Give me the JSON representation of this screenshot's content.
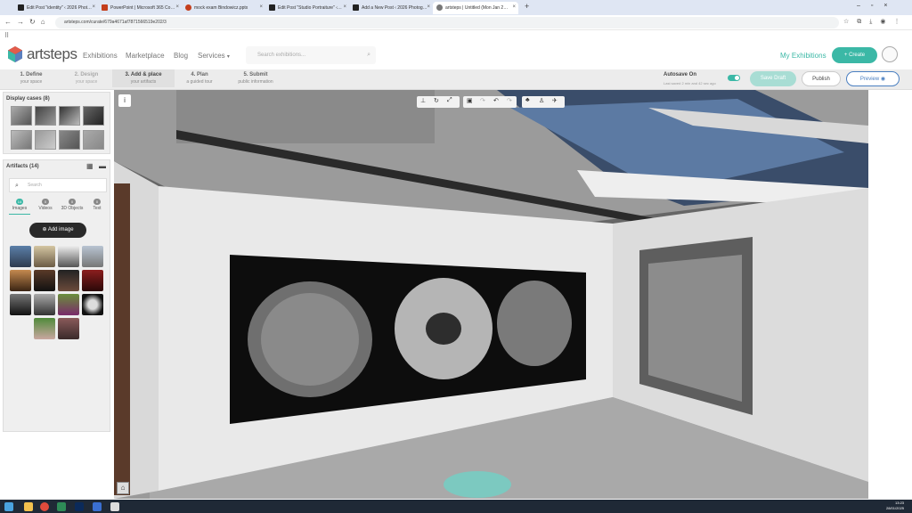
{
  "browser": {
    "tabs": [
      {
        "title": "Edit Post \"identity\" ‹ 2026 Phot…",
        "color": "#222"
      },
      {
        "title": "PowerPoint | Microsoft 365 Co…",
        "color": "#c43e1c"
      },
      {
        "title": "mock exam Bindowicz.pptx",
        "color": "#c43e1c"
      },
      {
        "title": "Edit Post \"Studio Portraiture\" ‹…",
        "color": "#222"
      },
      {
        "title": "Add a New Post ‹ 2026 Photog…",
        "color": "#222"
      },
      {
        "title": "artsteps | Untitled (Mon Jan 2…",
        "color": "#555"
      }
    ],
    "new_tab": "+",
    "url": "artsteps.com/curate/679a4671af7871566519e202/3"
  },
  "site": {
    "logo": "artsteps",
    "nav": {
      "exhibitions": "Exhibitions",
      "marketplace": "Marketplace",
      "blog": "Blog",
      "services": "Services"
    },
    "search_placeholder": "Search exhibitions...",
    "my_exhibitions": "My Exhibitions",
    "create": "+ Create"
  },
  "steps": [
    {
      "title": "1. Define",
      "sub": "your space"
    },
    {
      "title": "2. Design",
      "sub": "your space"
    },
    {
      "title": "3. Add & place",
      "sub": "your artifacts"
    },
    {
      "title": "4. Plan",
      "sub": "a guided tour"
    },
    {
      "title": "5. Submit",
      "sub": "public information"
    }
  ],
  "status": {
    "autosave": "Autosave On",
    "last_saved": "Last saved 2 min and 42 sec ago",
    "save_draft": "Save Draft",
    "publish": "Publish",
    "preview": "Preview"
  },
  "sidebar": {
    "display_cases_title": "Display cases (8)",
    "artifacts_title": "Artifacts (14)",
    "search_placeholder": "Search",
    "tabs": [
      {
        "label": "Images",
        "count": "14"
      },
      {
        "label": "Videos",
        "count": "0"
      },
      {
        "label": "3D Objects",
        "count": "0"
      },
      {
        "label": "Text",
        "count": "0"
      }
    ],
    "add_image": "Add image"
  },
  "taskbar": {
    "time": "13:23",
    "date": "28/01/2025"
  },
  "colors": {
    "accent": "#3bb8a6",
    "taskbar": "#1f2936"
  }
}
